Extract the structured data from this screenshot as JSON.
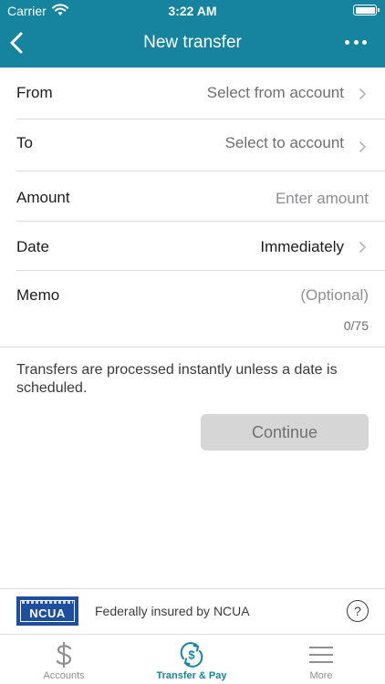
{
  "status_bar": {
    "carrier": "Carrier",
    "time": "3:22 AM"
  },
  "header": {
    "title": "New transfer"
  },
  "form": {
    "from": {
      "label": "From",
      "value": "Select from account"
    },
    "to": {
      "label": "To",
      "value": "Select to account"
    },
    "amount": {
      "label": "Amount",
      "placeholder": "Enter amount"
    },
    "date": {
      "label": "Date",
      "value": "Immediately"
    },
    "memo": {
      "label": "Memo",
      "placeholder": "(Optional)",
      "counter": "0/75"
    }
  },
  "note": "Transfers are processed instantly unless a date is scheduled.",
  "continue_label": "Continue",
  "ncua": {
    "logo_text": "NCUA",
    "text": "Federally insured by NCUA",
    "help": "?"
  },
  "tabs": [
    {
      "label": "Accounts",
      "icon": "dollar-icon",
      "active": false
    },
    {
      "label": "Transfer & Pay",
      "icon": "transfer-icon",
      "active": true
    },
    {
      "label": "More",
      "icon": "menu-icon",
      "active": false
    }
  ],
  "colors": {
    "primary": "#16839f",
    "button_disabled": "#d6d6d6"
  }
}
